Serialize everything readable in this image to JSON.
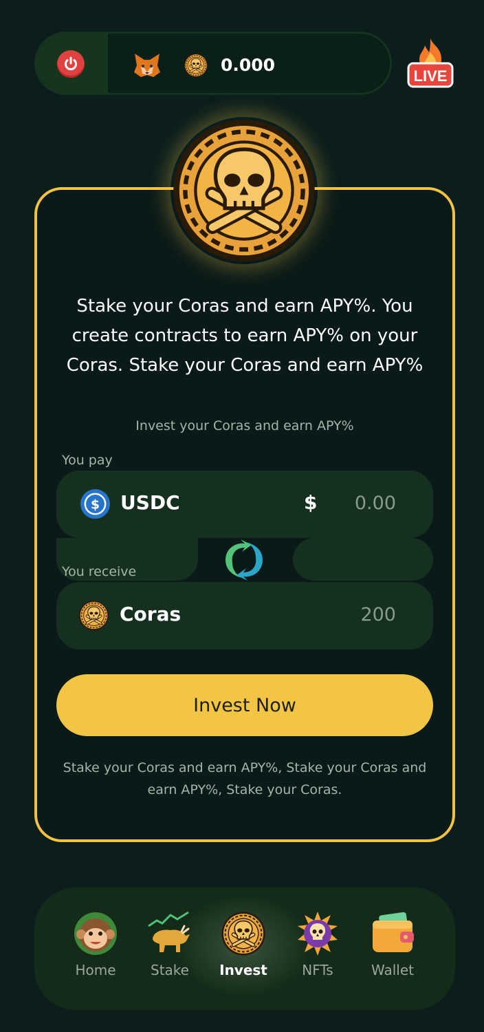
{
  "topbar": {
    "balance": "0.000",
    "power_icon": "power-icon",
    "wallet_icon": "metamask-fox-icon",
    "token_icon": "skull-coin-icon",
    "live_label": "LIVE"
  },
  "card": {
    "headline": "Stake your Coras and earn APY%. You create contracts to earn APY% on your Coras. Stake your Coras and earn APY%",
    "subline": "Invest your Coras and earn APY%",
    "pay_label": "You pay",
    "receive_label": "You receive",
    "pay_token": "USDC",
    "currency_symbol": "$",
    "pay_amount": "0.00",
    "receive_token": "Coras",
    "receive_amount": "200",
    "invest_button": "Invest Now",
    "footnote": "Stake your Coras and earn APY%, Stake your Coras and earn APY%, Stake your Coras."
  },
  "nav": {
    "items": [
      {
        "label": "Home",
        "icon": "monkey-icon"
      },
      {
        "label": "Stake",
        "icon": "bull-chart-icon"
      },
      {
        "label": "Invest",
        "icon": "skull-coin-icon"
      },
      {
        "label": "NFTs",
        "icon": "skull-badge-icon"
      },
      {
        "label": "Wallet",
        "icon": "wallet-icon"
      }
    ]
  },
  "colors": {
    "background": "#0b1e1c",
    "accent": "#f2c244",
    "field": "#16301f",
    "live_red": "#e8453c"
  }
}
